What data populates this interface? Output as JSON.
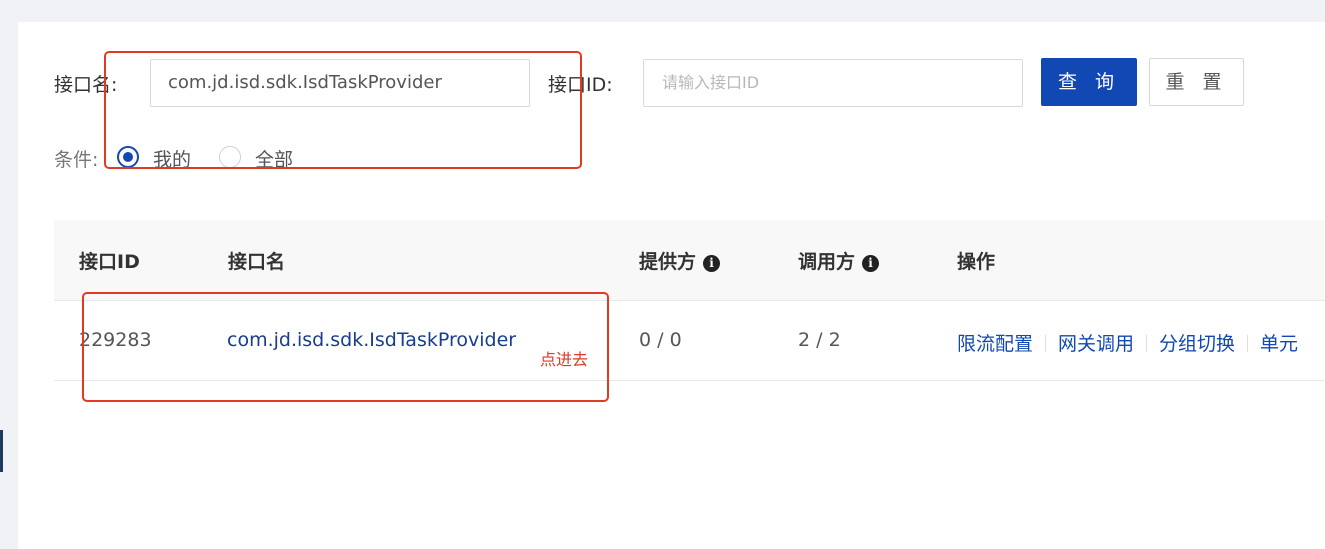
{
  "filter": {
    "interface_name_label": "接口名:",
    "interface_name_value": "com.jd.isd.sdk.IsdTaskProvider",
    "interface_id_label": "接口ID:",
    "interface_id_placeholder": "请输入接口ID",
    "query_label": "查 询",
    "reset_label": "重 置",
    "condition_label": "条件:",
    "options": [
      {
        "label": "我的",
        "selected": true
      },
      {
        "label": "全部",
        "selected": false
      }
    ]
  },
  "table": {
    "columns": [
      "接口ID",
      "接口名",
      "提供方",
      "调用方",
      "操作"
    ],
    "rows": [
      {
        "id": "229283",
        "name": "com.jd.isd.sdk.IsdTaskProvider",
        "provider": "0 / 0",
        "consumer": "2 / 2",
        "actions": [
          "限流配置",
          "网关调用",
          "分组切换",
          "单元"
        ]
      }
    ]
  },
  "annotation": {
    "text": "点进去",
    "color": "#e03a22"
  },
  "colors": {
    "primary": "#1148b3",
    "link": "#1a3c8f",
    "background": "#f0f2f5"
  }
}
